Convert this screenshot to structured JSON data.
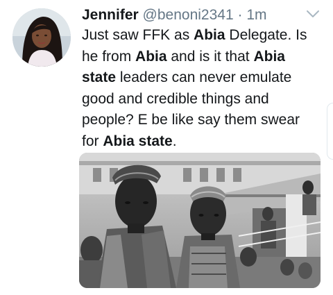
{
  "tweet": {
    "display_name": "Jennifer",
    "handle": "@benoni2341",
    "separator": " · ",
    "timestamp": "1m",
    "text_segments": [
      {
        "text": "Just saw FFK as ",
        "bold": false
      },
      {
        "text": "Abia",
        "bold": true
      },
      {
        "text": " Delegate. Is he from ",
        "bold": false
      },
      {
        "text": "Abia",
        "bold": true
      },
      {
        "text": " and is it that ",
        "bold": false
      },
      {
        "text": "Abia state",
        "bold": true
      },
      {
        "text": " leaders can never emulate good and credible things and people? E be like say them swear for ",
        "bold": false
      },
      {
        "text": "Abia state",
        "bold": true
      },
      {
        "text": ".",
        "bold": false
      }
    ]
  },
  "icons": {
    "menu": "chevron-down-icon"
  },
  "media": {
    "kind": "black-and-white photograph"
  },
  "colors": {
    "text": "#14171a",
    "secondary": "#657786",
    "caret": "#aab8c2"
  }
}
